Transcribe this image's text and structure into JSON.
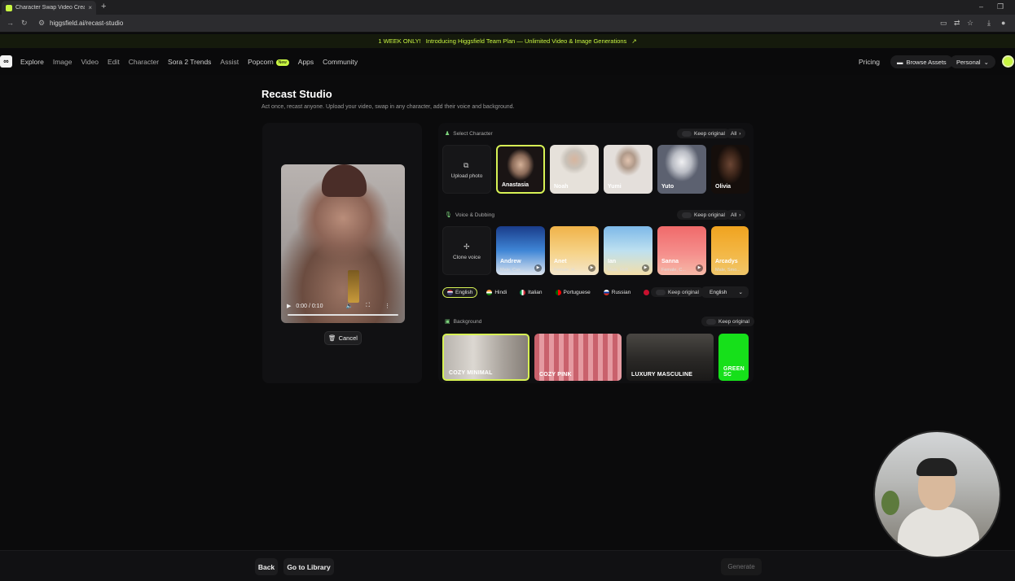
{
  "browser": {
    "tab_title": "Character Swap Video Creato",
    "tab_close": "×",
    "new_tab": "+",
    "url": "higgsfield.ai/recast-studio"
  },
  "promo": {
    "badge": "1 WEEK ONLY!",
    "text": "Introducing Higgsfield Team Plan — Unlimited Video & Image Generations",
    "arrow": "↗"
  },
  "nav": {
    "items": [
      "Explore",
      "Image",
      "Video",
      "Edit",
      "Character",
      "Sora 2 Trends",
      "Assist",
      "Popcorn",
      "Apps",
      "Community"
    ],
    "popcorn_badge": "New",
    "pricing": "Pricing",
    "browse_assets": "Browse Assets",
    "workspace": "Personal"
  },
  "page": {
    "title": "Recast Studio",
    "subtitle": "Act once, recast anyone. Upload your video, swap in any character, add their voice and background."
  },
  "video": {
    "time": "0:00 / 0:10",
    "cancel": "Cancel"
  },
  "character": {
    "label": "Select Character",
    "keep_original": "Keep original",
    "all": "All",
    "upload": "Upload photo",
    "cards": [
      {
        "name": "Anastasia"
      },
      {
        "name": "Noah"
      },
      {
        "name": "Yumi"
      },
      {
        "name": "Yuto"
      },
      {
        "name": "Olivia"
      }
    ]
  },
  "voice": {
    "label": "Voice & Dubbing",
    "keep_original": "Keep original",
    "all": "All",
    "clone": "Clone voice",
    "cards": [
      {
        "name": "Andrew",
        "desc": "Male, Cas..."
      },
      {
        "name": "Anet",
        "desc": "Female, H..."
      },
      {
        "name": "Ian",
        "desc": "Male, Refl..."
      },
      {
        "name": "Sanna",
        "desc": "Female, C..."
      },
      {
        "name": "Arcadys",
        "desc": "Male, Smo..."
      }
    ]
  },
  "languages": {
    "items": [
      "English",
      "Hindi",
      "Italian",
      "Portuguese",
      "Russian"
    ],
    "keep_original": "Keep original",
    "selected": "English"
  },
  "background": {
    "label": "Background",
    "keep_original": "Keep original",
    "cards": [
      "COZY MINIMAL",
      "COZY PINK",
      "LUXURY MASCULINE",
      "GREEN SC"
    ]
  },
  "footer": {
    "back": "Back",
    "library": "Go to Library",
    "generate": "Generate"
  },
  "colors": {
    "accent": "#c8f542",
    "selected_border": "#d7f255"
  }
}
